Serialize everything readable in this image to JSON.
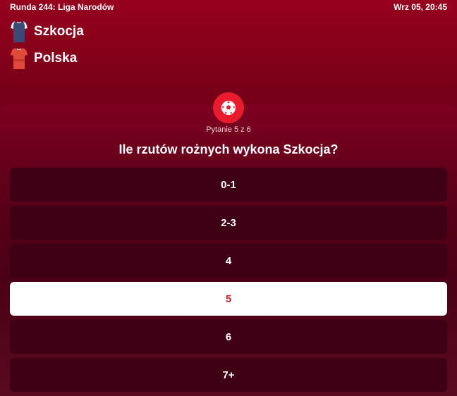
{
  "header": {
    "round_label": "Runda 244: Liga Narodów",
    "match_time": "Wrz 05, 20:45"
  },
  "teams": [
    {
      "name": "Szkocja",
      "jersey_icon": "jersey-icon",
      "jersey_color": "#3b4a78"
    },
    {
      "name": "Polska",
      "jersey_icon": "jersey-icon",
      "jersey_color": "#e04a3a"
    }
  ],
  "quiz": {
    "icon": "soccer-ball-icon",
    "progress_text": "Pytanie 5 z 6",
    "current_question": 5,
    "total_questions": 6,
    "question": "Ile rzutów rożnych wykona Szkocja?",
    "options": [
      {
        "label": "0-1",
        "selected": false
      },
      {
        "label": "2-3",
        "selected": false
      },
      {
        "label": "4",
        "selected": false
      },
      {
        "label": "5",
        "selected": true
      },
      {
        "label": "6",
        "selected": false
      },
      {
        "label": "7+",
        "selected": false
      }
    ]
  },
  "colors": {
    "accent_red": "#e81c2c",
    "selected_text": "#d4202e",
    "option_bg": "#3f0016",
    "background": "#7a0019"
  }
}
